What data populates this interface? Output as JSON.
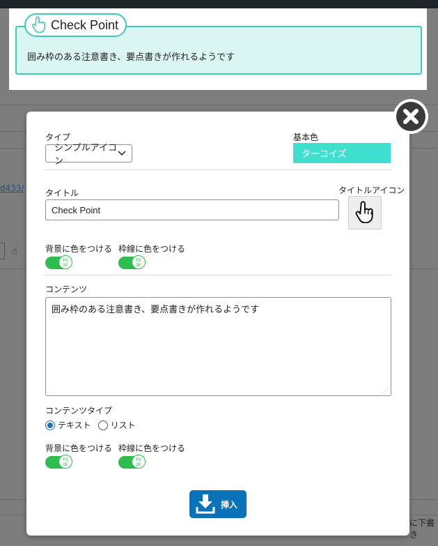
{
  "preview": {
    "title": "Check Point",
    "content": "囲み枠のある注意書き、要点書きが作れるようです",
    "accent_color": "#3fc9b8",
    "box_bg": "#d9f6f2",
    "icon": "hand-pointer-icon"
  },
  "background": {
    "link_fragment": "d433/",
    "right_fragment": "に下書き"
  },
  "modal": {
    "type_label": "タイプ",
    "type_value": "シンプルアイコン",
    "base_color_label": "基本色",
    "base_color_value": "ターコイズ",
    "base_color_hex": "#40e0d0",
    "title_label": "タイトル",
    "title_value": "Check Point",
    "title_icon_label": "タイトルアイコン",
    "title_icon": "hand-pointer-icon",
    "title_bg_toggle_label": "背景に色をつける",
    "title_border_toggle_label": "枠線に色をつける",
    "toggle_knob_text": "FOOE",
    "content_label": "コンテンツ",
    "content_value": "囲み枠のある注意書き、要点書きが作れるようです",
    "content_type_label": "コンテンツタイプ",
    "content_type_options": [
      "テキスト",
      "リスト"
    ],
    "content_type_selected": "テキスト",
    "content_bg_toggle_label": "背景に色をつける",
    "content_border_toggle_label": "枠線に色をつける",
    "insert_button": "挿入",
    "insert_icon": "download-icon",
    "close_icon": "close-icon"
  }
}
